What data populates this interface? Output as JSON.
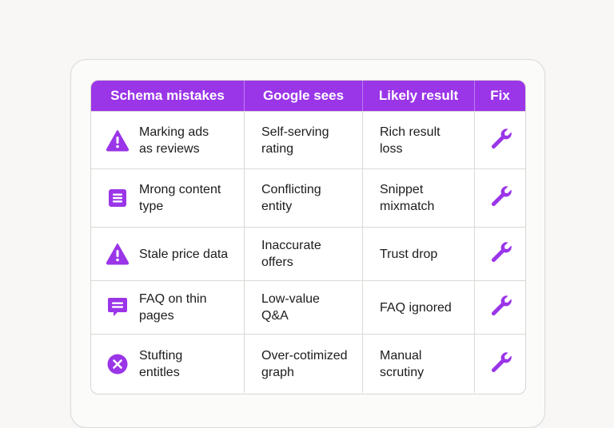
{
  "colors": {
    "accent": "#9a35e8",
    "header_text": "#ffffff"
  },
  "table": {
    "headers": [
      "Schema mistakes",
      "Google sees",
      "Likely result",
      "Fix"
    ],
    "rows": [
      {
        "icon": "warning-triangle-icon",
        "mistake": "Marking ads\nas reviews",
        "sees": "Self-serving\nrating",
        "result": "Rich result\nloss",
        "fix_icon": "wrench-icon"
      },
      {
        "icon": "document-list-icon",
        "mistake": "Mrong content\ntype",
        "sees": "Conflicting\nentity",
        "result": "Snippet\nmixmatch",
        "fix_icon": "wrench-icon"
      },
      {
        "icon": "warning-triangle-icon",
        "mistake": "Stale price data",
        "sees": "Inaccurate\noffers",
        "result": "Trust drop",
        "fix_icon": "wrench-icon"
      },
      {
        "icon": "chat-bubble-icon",
        "mistake": "FAQ on thin\npages",
        "sees": "Low-value\nQ&A",
        "result": "FAQ ignored",
        "fix_icon": "wrench-icon"
      },
      {
        "icon": "x-circle-icon",
        "mistake": "Stufting\nentitles",
        "sees": "Over-cotimized\ngraph",
        "result": "Manual\nscrutiny",
        "fix_icon": "wrench-icon"
      }
    ]
  }
}
